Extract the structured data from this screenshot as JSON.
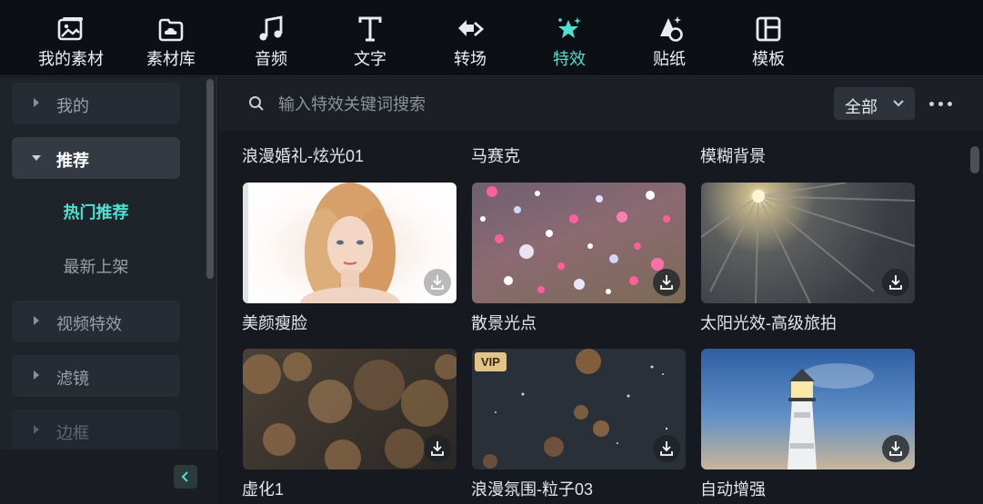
{
  "toolbar": {
    "tabs": [
      {
        "label": "我的素材",
        "icon": "my-media-icon"
      },
      {
        "label": "素材库",
        "icon": "cloud-library-icon"
      },
      {
        "label": "音频",
        "icon": "music-note-icon"
      },
      {
        "label": "文字",
        "icon": "text-t-icon"
      },
      {
        "label": "转场",
        "icon": "transition-icon"
      },
      {
        "label": "特效",
        "icon": "sparkle-effects-icon"
      },
      {
        "label": "贴纸",
        "icon": "sticker-icon"
      },
      {
        "label": "模板",
        "icon": "template-layout-icon"
      }
    ],
    "active_tab": "特效",
    "accent_color": "#4fe0d2"
  },
  "sidebar": {
    "items": [
      {
        "label": "我的",
        "expanded": false
      },
      {
        "label": "推荐",
        "expanded": true,
        "children": [
          "热门推荐",
          "最新上架"
        ],
        "selected_child": "热门推荐"
      },
      {
        "label": "视频特效",
        "expanded": false
      },
      {
        "label": "滤镜",
        "expanded": false
      },
      {
        "label": "边框",
        "expanded": false
      }
    ],
    "collapse_icon": "chevron-left-icon"
  },
  "search": {
    "placeholder": "输入特效关键词搜索",
    "value": "",
    "filter_value": "全部",
    "more_icon": "more-dots-icon"
  },
  "grid": {
    "header_captions": [
      "浪漫婚礼-炫光01",
      "马赛克",
      "模糊背景"
    ],
    "rows": [
      [
        {
          "caption": "美颜瘦脸",
          "thumbnail": "portrait-face",
          "vip": false
        },
        {
          "caption": "散景光点",
          "thumbnail": "bokeh-dots",
          "vip": false
        },
        {
          "caption": "太阳光效-高级旅拍",
          "thumbnail": "sun-rays",
          "vip": false
        }
      ],
      [
        {
          "caption": "虚化1",
          "thumbnail": "blur-bokeh",
          "vip": false
        },
        {
          "caption": "浪漫氛围-粒子03",
          "thumbnail": "particles",
          "vip": true,
          "vip_label": "VIP"
        },
        {
          "caption": "自动增强",
          "thumbnail": "lighthouse",
          "vip": false
        }
      ]
    ]
  }
}
